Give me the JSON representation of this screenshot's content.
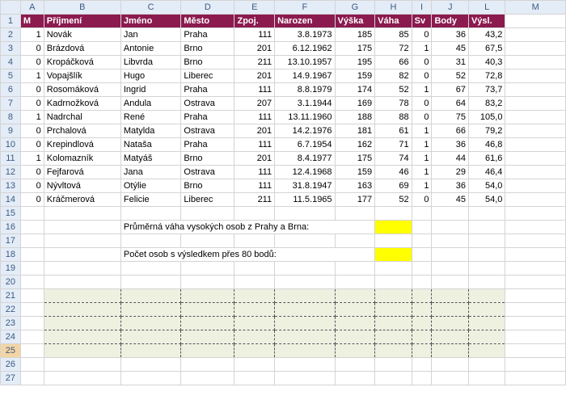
{
  "columns": [
    "A",
    "B",
    "C",
    "D",
    "E",
    "F",
    "G",
    "H",
    "I",
    "J",
    "L",
    "M"
  ],
  "selected_row": 25,
  "headers": {
    "A": "M",
    "B": "Příjmení",
    "C": "Jméno",
    "D": "Město",
    "E": "Zpoj.",
    "F": "Narozen",
    "G": "Výška",
    "H": "Váha",
    "I": "Sv",
    "J": "Body",
    "L": "Výsl."
  },
  "rows": [
    {
      "n": 2,
      "M": 1,
      "prij": "Novák",
      "jm": "Jan",
      "mesto": "Praha",
      "zpoj": 111,
      "nar": "3.8.1973",
      "vyska": 185,
      "vaha": 85,
      "sv": 0,
      "body": 36,
      "vysl": "43,2"
    },
    {
      "n": 3,
      "M": 0,
      "prij": "Brázdová",
      "jm": "Antonie",
      "mesto": "Brno",
      "zpoj": 201,
      "nar": "6.12.1962",
      "vyska": 175,
      "vaha": 72,
      "sv": 1,
      "body": 45,
      "vysl": "67,5"
    },
    {
      "n": 4,
      "M": 0,
      "prij": "Kropáčková",
      "jm": "Libvrda",
      "mesto": "Brno",
      "zpoj": 211,
      "nar": "13.10.1957",
      "vyska": 195,
      "vaha": 66,
      "sv": 0,
      "body": 31,
      "vysl": "40,3"
    },
    {
      "n": 5,
      "M": 1,
      "prij": "Vopajšlík",
      "jm": "Hugo",
      "mesto": "Liberec",
      "zpoj": 201,
      "nar": "14.9.1967",
      "vyska": 159,
      "vaha": 82,
      "sv": 0,
      "body": 52,
      "vysl": "72,8"
    },
    {
      "n": 6,
      "M": 0,
      "prij": "Rosomáková",
      "jm": "Ingrid",
      "mesto": "Praha",
      "zpoj": 111,
      "nar": "8.8.1979",
      "vyska": 174,
      "vaha": 52,
      "sv": 1,
      "body": 67,
      "vysl": "73,7"
    },
    {
      "n": 7,
      "M": 0,
      "prij": "Kadrnožková",
      "jm": "Andula",
      "mesto": "Ostrava",
      "zpoj": 207,
      "nar": "3.1.1944",
      "vyska": 169,
      "vaha": 78,
      "sv": 0,
      "body": 64,
      "vysl": "83,2"
    },
    {
      "n": 8,
      "M": 1,
      "prij": "Nadrchal",
      "jm": "René",
      "mesto": "Praha",
      "zpoj": 111,
      "nar": "13.11.1960",
      "vyska": 188,
      "vaha": 88,
      "sv": 0,
      "body": 75,
      "vysl": "105,0"
    },
    {
      "n": 9,
      "M": 0,
      "prij": "Prchalová",
      "jm": "Matylda",
      "mesto": "Ostrava",
      "zpoj": 201,
      "nar": "14.2.1976",
      "vyska": 181,
      "vaha": 61,
      "sv": 1,
      "body": 66,
      "vysl": "79,2"
    },
    {
      "n": 10,
      "M": 0,
      "prij": "Krepindlová",
      "jm": "Nataša",
      "mesto": "Praha",
      "zpoj": 111,
      "nar": "6.7.1954",
      "vyska": 162,
      "vaha": 71,
      "sv": 1,
      "body": 36,
      "vysl": "46,8"
    },
    {
      "n": 11,
      "M": 1,
      "prij": "Kolomazník",
      "jm": "Matyáš",
      "mesto": "Brno",
      "zpoj": 201,
      "nar": "8.4.1977",
      "vyska": 175,
      "vaha": 74,
      "sv": 1,
      "body": 44,
      "vysl": "61,6"
    },
    {
      "n": 12,
      "M": 0,
      "prij": "Fejfarová",
      "jm": "Jana",
      "mesto": "Ostrava",
      "zpoj": 111,
      "nar": "12.4.1968",
      "vyska": 159,
      "vaha": 46,
      "sv": 1,
      "body": 29,
      "vysl": "46,4"
    },
    {
      "n": 13,
      "M": 0,
      "prij": "Nývltová",
      "jm": "Otýlie",
      "mesto": "Brno",
      "zpoj": 111,
      "nar": "31.8.1947",
      "vyska": 163,
      "vaha": 69,
      "sv": 1,
      "body": 36,
      "vysl": "54,0"
    },
    {
      "n": 14,
      "M": 0,
      "prij": "Kráčmerová",
      "jm": "Felicie",
      "mesto": "Liberec",
      "zpoj": 211,
      "nar": "11.5.1965",
      "vyska": 177,
      "vaha": 52,
      "sv": 0,
      "body": 45,
      "vysl": "54,0"
    }
  ],
  "notes": {
    "row16": "Průměrná váha vysokých osob z Prahy a Brna:",
    "row18": "Počet osob s výsledkem přes 80 bodů:"
  },
  "empty_rows": [
    15,
    16,
    17,
    18,
    19,
    20
  ],
  "dotted_rows": [
    21,
    22,
    23,
    24,
    25
  ],
  "tail_rows": [
    26,
    27
  ]
}
